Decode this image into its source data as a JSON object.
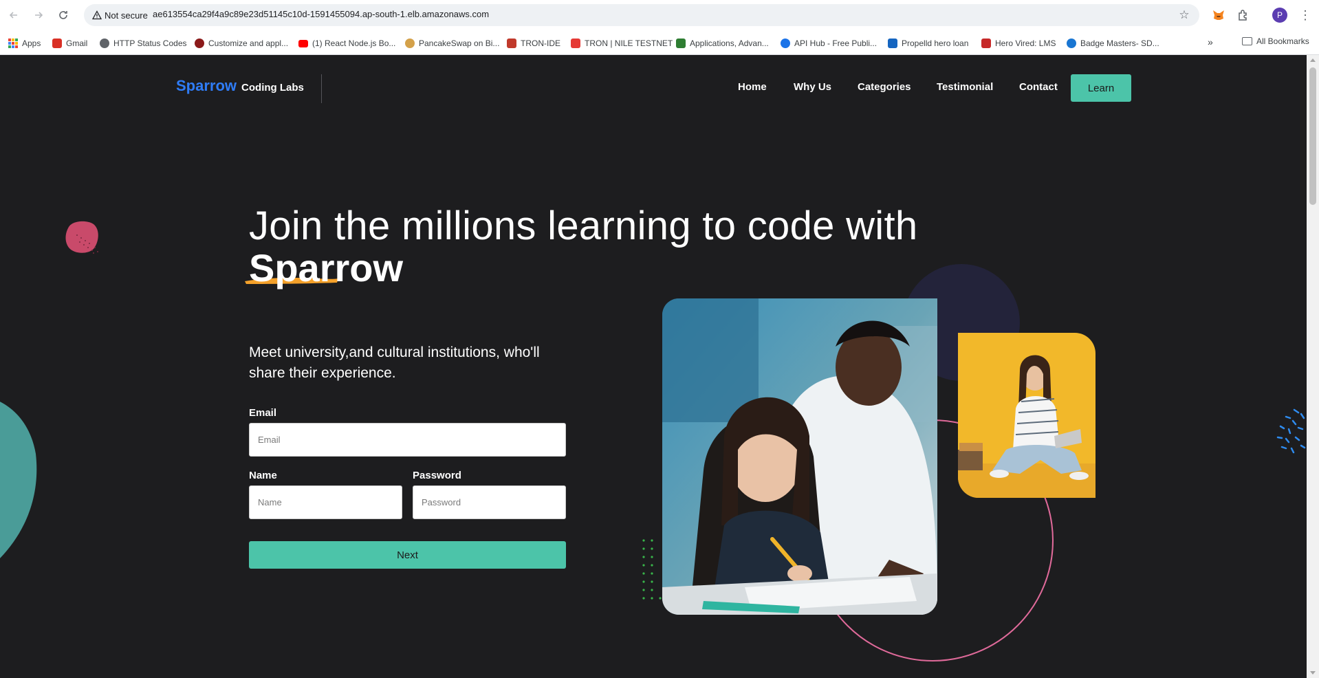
{
  "browser": {
    "security_label": "Not secure",
    "url": "ae613554ca29f4a9c89e23d51145c10d-1591455094.ap-south-1.elb.amazonaws.com",
    "profile_initial": "P",
    "bookmarks": [
      {
        "label": "Apps",
        "color": "#ea4335"
      },
      {
        "label": "Gmail",
        "color": "#d93025"
      },
      {
        "label": "HTTP Status Codes",
        "color": "#5f6368"
      },
      {
        "label": "Customize and appl...",
        "color": "#8b1a1a"
      },
      {
        "label": "(1) React Node.js Bo...",
        "color": "#ff0000"
      },
      {
        "label": "PancakeSwap on Bi...",
        "color": "#d4a14a"
      },
      {
        "label": "TRON-IDE",
        "color": "#c0392b"
      },
      {
        "label": "TRON | NILE TESTNET",
        "color": "#e53935"
      },
      {
        "label": "Applications, Advan...",
        "color": "#2e7d32"
      },
      {
        "label": "API Hub - Free Publi...",
        "color": "#1a73e8"
      },
      {
        "label": "Propelld hero loan",
        "color": "#1565c0"
      },
      {
        "label": "Hero Vired: LMS",
        "color": "#c62828"
      },
      {
        "label": "Badge Masters- SD...",
        "color": "#1976d2"
      }
    ],
    "all_bookmarks_label": "All Bookmarks"
  },
  "site": {
    "brand_main": "Sparrow",
    "brand_sub": "Coding Labs",
    "nav": [
      "Home",
      "Why Us",
      "Categories",
      "Testimonial",
      "Contact"
    ],
    "cta_label": "Learn"
  },
  "hero": {
    "title_line1": "Join the millions learning to code with",
    "title_accent": "Sparrow",
    "subtitle": "Meet university,and cultural institutions, who'll share their experience."
  },
  "form": {
    "email_label": "Email",
    "email_placeholder": "Email",
    "name_label": "Name",
    "name_placeholder": "Name",
    "password_label": "Password",
    "password_placeholder": "Password",
    "submit_label": "Next"
  },
  "colors": {
    "accent_teal": "#4cc4a9",
    "brand_blue": "#2f7cf6",
    "page_bg": "#1d1d1f",
    "brush_orange": "#f4a12b",
    "ring_pink": "#e06a9a"
  }
}
